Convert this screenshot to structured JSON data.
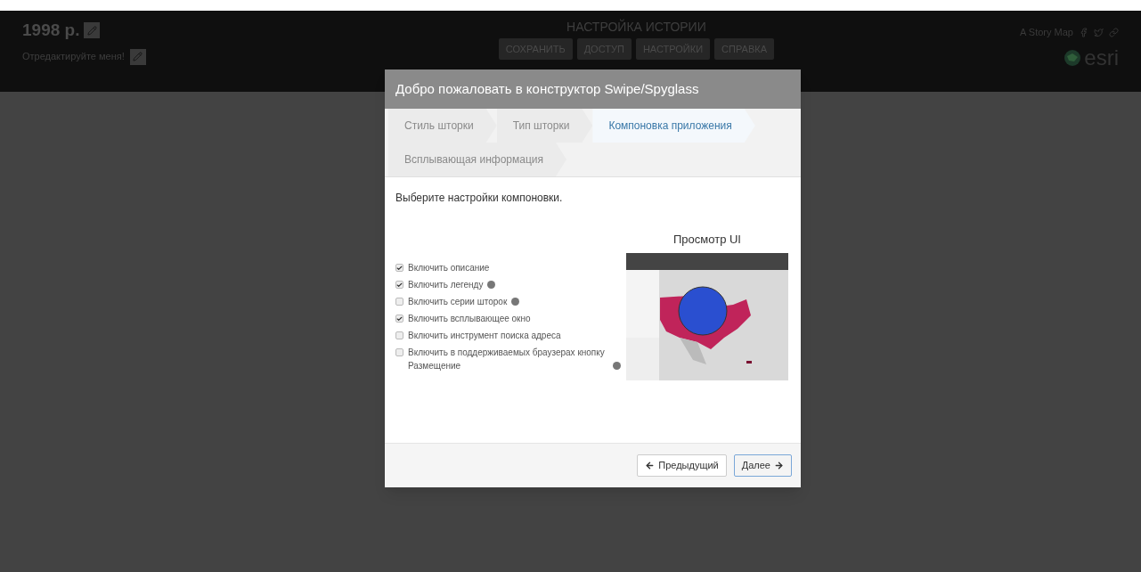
{
  "header": {
    "title": "1998 р.",
    "subtitle": "Отредактируйте меня!",
    "builder_title": "НАСТРОЙКА ИСТОРИИ",
    "builder_buttons": [
      "СОХРАНИТЬ",
      "ДОСТУП",
      "НАСТРОЙКИ",
      "СПРАВКА"
    ],
    "story_map_label": "A Story Map",
    "logo_text": "esri"
  },
  "dialog": {
    "title": "Добро пожаловать в конструктор Swipe/Spyglass",
    "steps": [
      {
        "label": "Стиль шторки",
        "selected": false
      },
      {
        "label": "Тип шторки",
        "selected": false
      },
      {
        "label": "Компоновка приложения",
        "selected": true
      },
      {
        "label": "Всплывающая информация",
        "selected": false
      }
    ],
    "instruction": "Выберите настройки компоновки.",
    "options": [
      {
        "label": "Включить описание",
        "checked": true,
        "help": false
      },
      {
        "label": "Включить легенду",
        "checked": true,
        "help": true
      },
      {
        "label": "Включить серии шторок",
        "checked": false,
        "help": true
      },
      {
        "label": "Включить всплывающее окно",
        "checked": true,
        "help": false
      },
      {
        "label": "Включить инструмент поиска адреса",
        "checked": false,
        "help": false
      },
      {
        "label": "Включить в поддерживаемых браузерах кнопку Размещение",
        "checked": false,
        "help": true
      }
    ],
    "preview_title": "Просмотр UI",
    "buttons": [
      {
        "label": "Предыдущий",
        "kind": "back",
        "selected": false
      },
      {
        "label": "Далее",
        "kind": "next",
        "selected": true
      }
    ]
  }
}
